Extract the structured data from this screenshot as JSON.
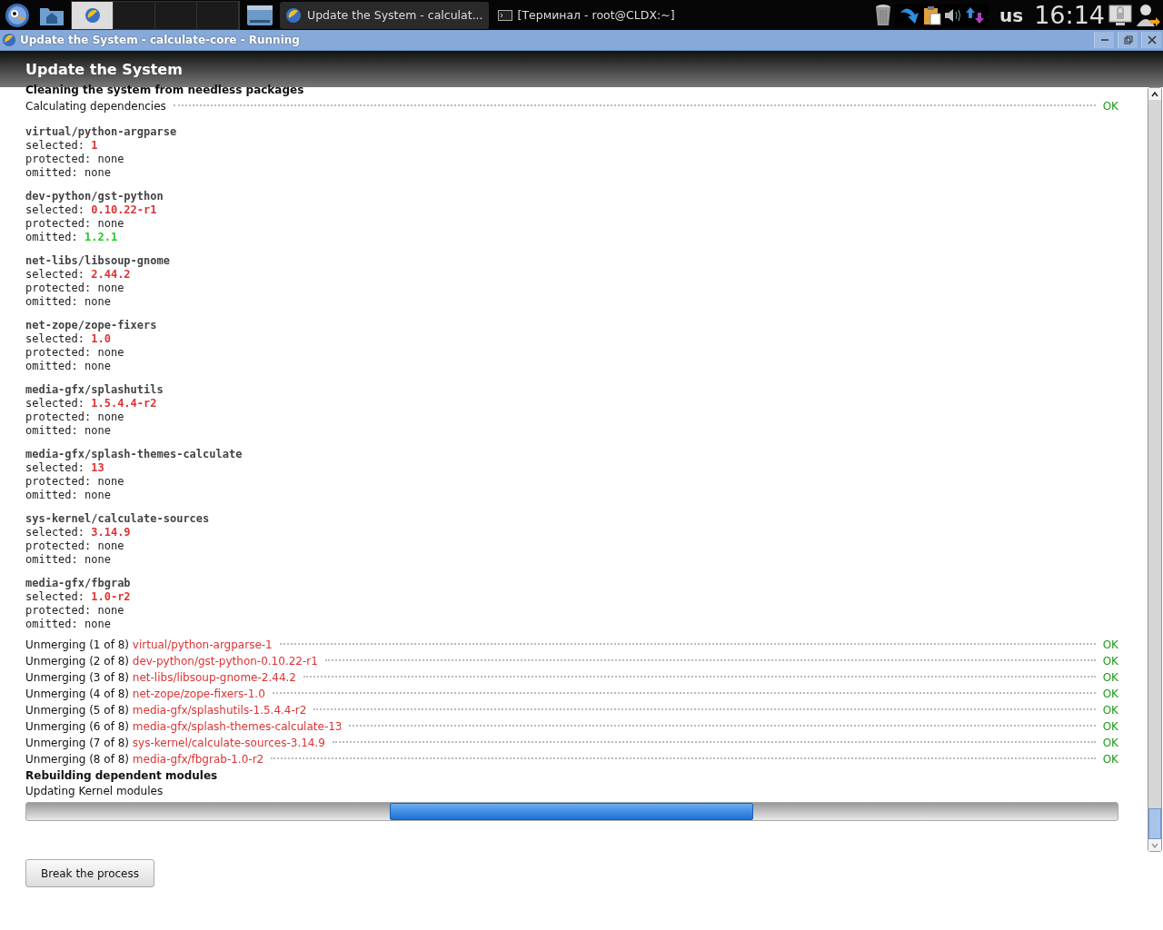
{
  "taskbar": {
    "desktops": [
      {
        "selected": true
      },
      {
        "selected": false
      },
      {
        "selected": false
      },
      {
        "selected": false
      }
    ],
    "tasks": [
      {
        "label": "Update the System - calculat...",
        "kind": "app",
        "selected": true
      },
      {
        "label": "[Терминал - root@CLDX:~]",
        "kind": "terminal",
        "selected": false
      }
    ],
    "keyboard_layout": "us",
    "clock": "16:14"
  },
  "window": {
    "title": "Update the System - calculate-core - Running",
    "heading": "Update the System"
  },
  "log": [
    {
      "kind": "heading",
      "text": "Cleaning the system from needless packages"
    },
    {
      "kind": "check",
      "text": "Calculating dependencies",
      "status": "OK"
    },
    {
      "kind": "package",
      "name": "virtual/python-argparse",
      "fields": [
        {
          "label": "selected:",
          "value": "1",
          "kind": "new"
        },
        {
          "label": "protected:",
          "value": "none",
          "kind": "none"
        },
        {
          "label": "omitted:",
          "value": "none",
          "kind": "none"
        }
      ]
    },
    {
      "kind": "package",
      "name": "dev-python/gst-python",
      "fields": [
        {
          "label": "selected:",
          "value": "0.10.22-r1",
          "kind": "new"
        },
        {
          "label": "protected:",
          "value": "none",
          "kind": "none"
        },
        {
          "label": "omitted:",
          "value": "1.2.1",
          "kind": "old"
        }
      ]
    },
    {
      "kind": "package",
      "name": "net-libs/libsoup-gnome",
      "fields": [
        {
          "label": "selected:",
          "value": "2.44.2",
          "kind": "new"
        },
        {
          "label": "protected:",
          "value": "none",
          "kind": "none"
        },
        {
          "label": "omitted:",
          "value": "none",
          "kind": "none"
        }
      ]
    },
    {
      "kind": "package",
      "name": "net-zope/zope-fixers",
      "fields": [
        {
          "label": "selected:",
          "value": "1.0",
          "kind": "new"
        },
        {
          "label": "protected:",
          "value": "none",
          "kind": "none"
        },
        {
          "label": "omitted:",
          "value": "none",
          "kind": "none"
        }
      ]
    },
    {
      "kind": "package",
      "name": "media-gfx/splashutils",
      "fields": [
        {
          "label": "selected:",
          "value": "1.5.4.4-r2",
          "kind": "new"
        },
        {
          "label": "protected:",
          "value": "none",
          "kind": "none"
        },
        {
          "label": "omitted:",
          "value": "none",
          "kind": "none"
        }
      ]
    },
    {
      "kind": "package",
      "name": "media-gfx/splash-themes-calculate",
      "fields": [
        {
          "label": "selected:",
          "value": "13",
          "kind": "new"
        },
        {
          "label": "protected:",
          "value": "none",
          "kind": "none"
        },
        {
          "label": "omitted:",
          "value": "none",
          "kind": "none"
        }
      ]
    },
    {
      "kind": "package",
      "name": "sys-kernel/calculate-sources",
      "fields": [
        {
          "label": "selected:",
          "value": "3.14.9",
          "kind": "new"
        },
        {
          "label": "protected:",
          "value": "none",
          "kind": "none"
        },
        {
          "label": "omitted:",
          "value": "none",
          "kind": "none"
        }
      ]
    },
    {
      "kind": "package",
      "name": "media-gfx/fbgrab",
      "fields": [
        {
          "label": "selected:",
          "value": "1.0-r2",
          "kind": "new"
        },
        {
          "label": "protected:",
          "value": "none",
          "kind": "none"
        },
        {
          "label": "omitted:",
          "value": "none",
          "kind": "none"
        }
      ]
    },
    {
      "kind": "unmerge",
      "text": "Unmerging (1 of 8)",
      "package": "virtual/python-argparse-1",
      "status": "OK"
    },
    {
      "kind": "unmerge",
      "text": "Unmerging (2 of 8)",
      "package": "dev-python/gst-python-0.10.22-r1",
      "status": "OK"
    },
    {
      "kind": "unmerge",
      "text": "Unmerging (3 of 8)",
      "package": "net-libs/libsoup-gnome-2.44.2",
      "status": "OK"
    },
    {
      "kind": "unmerge",
      "text": "Unmerging (4 of 8)",
      "package": "net-zope/zope-fixers-1.0",
      "status": "OK"
    },
    {
      "kind": "unmerge",
      "text": "Unmerging (5 of 8)",
      "package": "media-gfx/splashutils-1.5.4.4-r2",
      "status": "OK"
    },
    {
      "kind": "unmerge",
      "text": "Unmerging (6 of 8)",
      "package": "media-gfx/splash-themes-calculate-13",
      "status": "OK"
    },
    {
      "kind": "unmerge",
      "text": "Unmerging (7 of 8)",
      "package": "sys-kernel/calculate-sources-3.14.9",
      "status": "OK"
    },
    {
      "kind": "unmerge",
      "text": "Unmerging (8 of 8)",
      "package": "media-gfx/fbgrab-1.0-r2",
      "status": "OK"
    },
    {
      "kind": "heading",
      "text": "Rebuilding dependent modules"
    },
    {
      "kind": "info",
      "text": "Updating Kernel modules"
    }
  ],
  "progress": {
    "busy": true
  },
  "button": "Break the process"
}
